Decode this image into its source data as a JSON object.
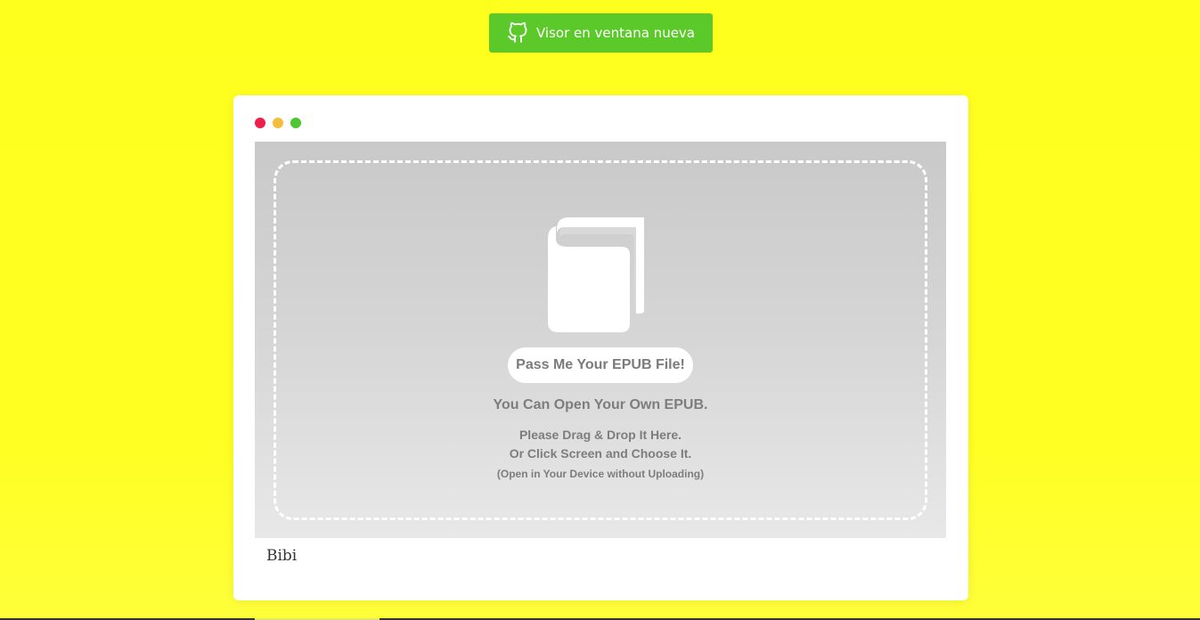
{
  "header": {
    "open_window_button": {
      "label": "Visor en ventana nueva",
      "icon": "github-icon",
      "color": "#5cc92a"
    }
  },
  "window": {
    "controls": [
      "close",
      "minimize",
      "maximize"
    ],
    "viewer": {
      "badge_label": "Pass Me Your EPUB File!",
      "headline": "You Can Open Your Own EPUB.",
      "instruction_drag": "Please Drag & Drop It Here.",
      "instruction_click": "Or Click Screen and Choose It.",
      "note": "(Open in Your Device without Uploading)",
      "icon": "book-icon"
    },
    "caption": "Bibi"
  },
  "colors": {
    "background": "#ffff1e",
    "button_green": "#5cc92a",
    "dot_red": "#ef1e4a",
    "dot_yellow": "#f2be3c",
    "dot_green": "#4fc631"
  }
}
